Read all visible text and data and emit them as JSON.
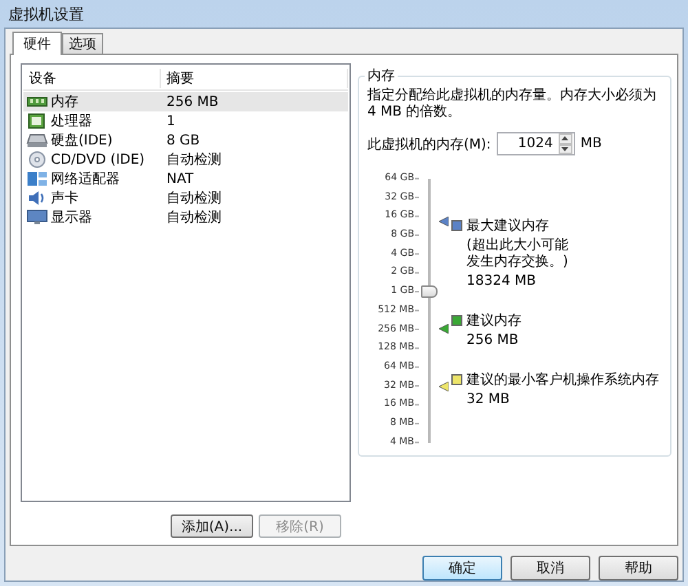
{
  "window": {
    "title": "虚拟机设置"
  },
  "tabs": [
    {
      "label": "硬件",
      "selected": true
    },
    {
      "label": "选项",
      "selected": false
    }
  ],
  "device_table": {
    "columns": [
      "设备",
      "摘要"
    ],
    "rows": [
      {
        "kind": "memory",
        "device": "内存",
        "summary": "256 MB",
        "selected": true
      },
      {
        "kind": "processor",
        "device": "处理器",
        "summary": "1",
        "selected": false
      },
      {
        "kind": "disk",
        "device": "硬盘(IDE)",
        "summary": "8 GB",
        "selected": false
      },
      {
        "kind": "cd",
        "device": "CD/DVD (IDE)",
        "summary": "自动检测",
        "selected": false
      },
      {
        "kind": "network",
        "device": "网络适配器",
        "summary": "NAT",
        "selected": false
      },
      {
        "kind": "sound",
        "device": "声卡",
        "summary": "自动检测",
        "selected": false
      },
      {
        "kind": "display",
        "device": "显示器",
        "summary": "自动检测",
        "selected": false
      }
    ]
  },
  "device_buttons": [
    {
      "label": "添加(A)...",
      "disabled": false
    },
    {
      "label": "移除(R)",
      "disabled": true
    }
  ],
  "memory": {
    "title": "内存",
    "description": "指定分配给此虚拟机的内存量。内存大小必须为 4 MB 的倍数。",
    "field_label": "此虚拟机的内存(M):",
    "value": "1024",
    "unit": "MB",
    "scale": [
      "64 GB",
      "32 GB",
      "16 GB",
      "8 GB",
      "4 GB",
      "2 GB",
      "1 GB",
      "512 MB",
      "256 MB",
      "128 MB",
      "64 MB",
      "32 MB",
      "16 MB",
      "8 MB",
      "4 MB"
    ],
    "slider": {
      "level": 0.571
    },
    "markers": [
      {
        "color": "#5b82c6",
        "level": 0.84,
        "label": "最大建议内存",
        "note": "(超出此大小可能发生内存交换。)",
        "value": "18324 MB"
      },
      {
        "color": "#3aa835",
        "level": 0.429,
        "label": "建议内存",
        "value": "256 MB"
      },
      {
        "color": "#ede56a",
        "level": 0.214,
        "label": "建议的最小客户机操作系统内存",
        "value": "32 MB"
      }
    ]
  },
  "buttons": [
    {
      "label": "确定",
      "default": true
    },
    {
      "label": "取消",
      "default": false
    },
    {
      "label": "帮助",
      "default": false
    }
  ]
}
